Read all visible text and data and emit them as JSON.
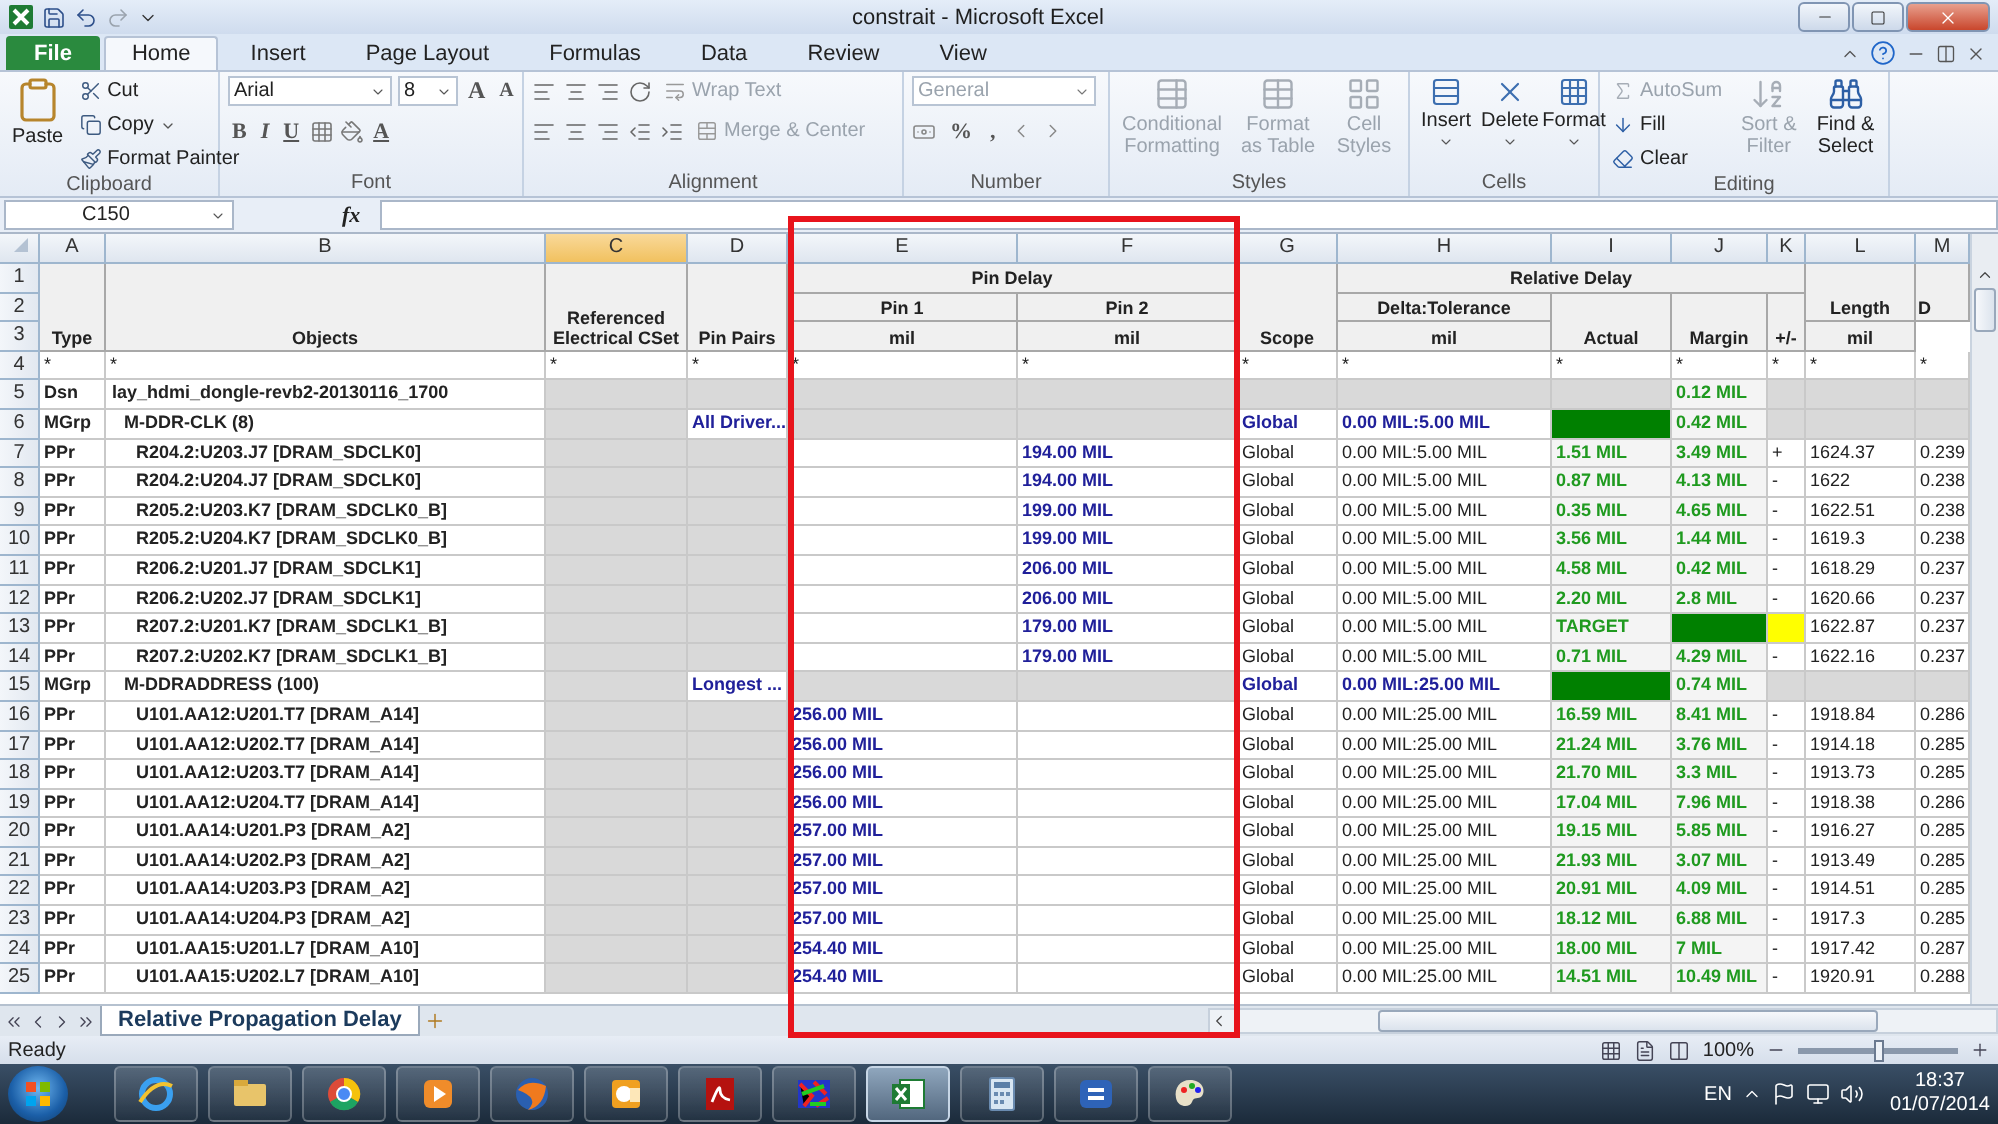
{
  "window": {
    "title": "constrait - Microsoft Excel"
  },
  "ribbon": {
    "tabs": [
      {
        "label": "File",
        "kind": "file",
        "selected": false
      },
      {
        "label": "Home",
        "kind": "tab",
        "selected": true
      },
      {
        "label": "Insert",
        "kind": "tab",
        "selected": false
      },
      {
        "label": "Page Layout",
        "kind": "tab",
        "selected": false
      },
      {
        "label": "Formulas",
        "kind": "tab",
        "selected": false
      },
      {
        "label": "Data",
        "kind": "tab",
        "selected": false
      },
      {
        "label": "Review",
        "kind": "tab",
        "selected": false
      },
      {
        "label": "View",
        "kind": "tab",
        "selected": false
      }
    ],
    "groups": [
      {
        "kind": "clipboard",
        "label": "Clipboard",
        "paste": "Paste",
        "items": [
          {
            "label": "Cut",
            "dropdown": false
          },
          {
            "label": "Copy",
            "dropdown": true
          },
          {
            "label": "Format Painter",
            "dropdown": false
          }
        ]
      },
      {
        "kind": "font",
        "label": "Font",
        "font": "Arial",
        "size": "8",
        "size_buttons": [
          "A",
          "A"
        ],
        "styles": [
          "B",
          "I",
          "U"
        ],
        "color_button": "A"
      },
      {
        "kind": "alignment",
        "label": "Alignment",
        "wrap": {
          "label": "Wrap Text",
          "disabled": true
        },
        "merge": {
          "label": "Merge & Center",
          "disabled": true
        }
      },
      {
        "kind": "number",
        "label": "Number",
        "format": {
          "value": "General",
          "disabled": true
        },
        "symbols": [
          "%",
          ","
        ]
      },
      {
        "kind": "styles",
        "label": "Styles",
        "items": [
          {
            "label": "Conditional Formatting",
            "disabled": true
          },
          {
            "label": "Format as Table",
            "disabled": true
          },
          {
            "label": "Cell Styles",
            "disabled": true
          }
        ]
      },
      {
        "kind": "cells",
        "label": "Cells",
        "items": [
          {
            "label": "Insert",
            "disabled": false
          },
          {
            "label": "Delete",
            "disabled": false
          },
          {
            "label": "Format",
            "disabled": false
          }
        ]
      },
      {
        "kind": "editing",
        "label": "Editing",
        "small": [
          {
            "label": "AutoSum",
            "disabled": true
          },
          {
            "label": "Fill",
            "disabled": false
          },
          {
            "label": "Clear",
            "disabled": false
          }
        ],
        "large": [
          {
            "label": "Sort & Filter",
            "disabled": true
          },
          {
            "label": "Find & Select",
            "disabled": false
          }
        ]
      }
    ]
  },
  "formula_bar": {
    "name_box": "C150",
    "function_label": "fx"
  },
  "sheet": {
    "columns": [
      {
        "letter": "A",
        "selected": false
      },
      {
        "letter": "B",
        "selected": false
      },
      {
        "letter": "C",
        "selected": true
      },
      {
        "letter": "D",
        "selected": false
      },
      {
        "letter": "E",
        "selected": false
      },
      {
        "letter": "F",
        "selected": false
      },
      {
        "letter": "G",
        "selected": false
      },
      {
        "letter": "H",
        "selected": false
      },
      {
        "letter": "I",
        "selected": false
      },
      {
        "letter": "J",
        "selected": false
      },
      {
        "letter": "K",
        "selected": false
      },
      {
        "letter": "L",
        "selected": false
      },
      {
        "letter": "M",
        "selected": false
      }
    ],
    "row_numbers": [
      "1",
      "2",
      "3",
      "4",
      "5",
      "6",
      "7",
      "8",
      "9",
      "10",
      "11",
      "12",
      "13",
      "14",
      "15",
      "16",
      "17",
      "18",
      "19",
      "20",
      "21",
      "22",
      "23",
      "24",
      "25"
    ],
    "header": [
      "Type",
      "Objects",
      "Referenced Electrical CSet",
      "Pin Pairs",
      "Pin Delay",
      "Pin 1",
      "Pin 2",
      "mil",
      "mil",
      "Scope",
      "Relative Delay",
      "Delta:Tolerance",
      "mil",
      "Actual",
      "Margin",
      "+/-",
      "Length",
      "mil",
      "D"
    ],
    "filters": [
      "*",
      "*",
      "*",
      "*",
      "*",
      "*",
      "*",
      "*",
      "*",
      "*",
      "*",
      "*",
      "*"
    ],
    "rows": [
      {
        "kind": "design",
        "type": "Dsn",
        "object": "lay_hdmi_dongle-revb2-20130116_1700",
        "margin": "0.12 MIL",
        "children": [
          {
            "kind": "group",
            "type": "MGrp",
            "object": "M-DDR-CLK (8)",
            "pin_pairs": "All Driver...",
            "scope": "Global",
            "tolerance": "0.00 MIL:5.00 MIL",
            "actual_pass": true,
            "margin": "0.42 MIL",
            "children": [
              {
                "kind": "pair",
                "type": "PPr",
                "object": "R204.2:U203.J7 [DRAM_SDCLK0]",
                "pin2": "194.00 MIL",
                "scope": "Global",
                "tolerance": "0.00 MIL:5.00 MIL",
                "actual": "1.51 MIL",
                "margin": "3.49 MIL",
                "sign": "+",
                "length": "1624.37",
                "col_m": "0.239"
              },
              {
                "kind": "pair",
                "type": "PPr",
                "object": "R204.2:U204.J7 [DRAM_SDCLK0]",
                "pin2": "194.00 MIL",
                "scope": "Global",
                "tolerance": "0.00 MIL:5.00 MIL",
                "actual": "0.87 MIL",
                "margin": "4.13 MIL",
                "sign": "-",
                "length": "1622",
                "col_m": "0.238"
              },
              {
                "kind": "pair",
                "type": "PPr",
                "object": "R205.2:U203.K7 [DRAM_SDCLK0_B]",
                "pin2": "199.00 MIL",
                "scope": "Global",
                "tolerance": "0.00 MIL:5.00 MIL",
                "actual": "0.35 MIL",
                "margin": "4.65 MIL",
                "sign": "-",
                "length": "1622.51",
                "col_m": "0.238"
              },
              {
                "kind": "pair",
                "type": "PPr",
                "object": "R205.2:U204.K7 [DRAM_SDCLK0_B]",
                "pin2": "199.00 MIL",
                "scope": "Global",
                "tolerance": "0.00 MIL:5.00 MIL",
                "actual": "3.56 MIL",
                "margin": "1.44 MIL",
                "sign": "-",
                "length": "1619.3",
                "col_m": "0.238"
              },
              {
                "kind": "pair",
                "type": "PPr",
                "object": "R206.2:U201.J7 [DRAM_SDCLK1]",
                "pin2": "206.00 MIL",
                "scope": "Global",
                "tolerance": "0.00 MIL:5.00 MIL",
                "actual": "4.58 MIL",
                "margin": "0.42 MIL",
                "sign": "-",
                "length": "1618.29",
                "col_m": "0.237"
              },
              {
                "kind": "pair",
                "type": "PPr",
                "object": "R206.2:U202.J7 [DRAM_SDCLK1]",
                "pin2": "206.00 MIL",
                "scope": "Global",
                "tolerance": "0.00 MIL:5.00 MIL",
                "actual": "2.20 MIL",
                "margin": "2.8 MIL",
                "sign": "-",
                "length": "1620.66",
                "col_m": "0.237"
              },
              {
                "kind": "pair",
                "type": "PPr",
                "object": "R207.2:U201.K7 [DRAM_SDCLK1_B]",
                "pin2": "179.00 MIL",
                "scope": "Global",
                "tolerance": "0.00 MIL:5.00 MIL",
                "actual": "TARGET",
                "margin_pass": true,
                "sign_warning": true,
                "length": "1622.87",
                "col_m": "0.237"
              },
              {
                "kind": "pair",
                "type": "PPr",
                "object": "R207.2:U202.K7 [DRAM_SDCLK1_B]",
                "pin2": "179.00 MIL",
                "scope": "Global",
                "tolerance": "0.00 MIL:5.00 MIL",
                "actual": "0.71 MIL",
                "margin": "4.29 MIL",
                "sign": "-",
                "length": "1622.16",
                "col_m": "0.237"
              }
            ]
          },
          {
            "kind": "group",
            "type": "MGrp",
            "object": "M-DDRADDRESS (100)",
            "pin_pairs": "Longest ...",
            "scope": "Global",
            "tolerance": "0.00 MIL:25.00 MIL",
            "actual_pass": true,
            "margin": "0.74 MIL",
            "children": [
              {
                "kind": "pair",
                "type": "PPr",
                "object": "U101.AA12:U201.T7 [DRAM_A14]",
                "pin1": "256.00 MIL",
                "scope": "Global",
                "tolerance": "0.00 MIL:25.00 MIL",
                "actual": "16.59 MIL",
                "margin": "8.41 MIL",
                "sign": "-",
                "length": "1918.84",
                "col_m": "0.286"
              },
              {
                "kind": "pair",
                "type": "PPr",
                "object": "U101.AA12:U202.T7 [DRAM_A14]",
                "pin1": "256.00 MIL",
                "scope": "Global",
                "tolerance": "0.00 MIL:25.00 MIL",
                "actual": "21.24 MIL",
                "margin": "3.76 MIL",
                "sign": "-",
                "length": "1914.18",
                "col_m": "0.285"
              },
              {
                "kind": "pair",
                "type": "PPr",
                "object": "U101.AA12:U203.T7 [DRAM_A14]",
                "pin1": "256.00 MIL",
                "scope": "Global",
                "tolerance": "0.00 MIL:25.00 MIL",
                "actual": "21.70 MIL",
                "margin": "3.3 MIL",
                "sign": "-",
                "length": "1913.73",
                "col_m": "0.285"
              },
              {
                "kind": "pair",
                "type": "PPr",
                "object": "U101.AA12:U204.T7 [DRAM_A14]",
                "pin1": "256.00 MIL",
                "scope": "Global",
                "tolerance": "0.00 MIL:25.00 MIL",
                "actual": "17.04 MIL",
                "margin": "7.96 MIL",
                "sign": "-",
                "length": "1918.38",
                "col_m": "0.286"
              },
              {
                "kind": "pair",
                "type": "PPr",
                "object": "U101.AA14:U201.P3 [DRAM_A2]",
                "pin1": "257.00 MIL",
                "scope": "Global",
                "tolerance": "0.00 MIL:25.00 MIL",
                "actual": "19.15 MIL",
                "margin": "5.85 MIL",
                "sign": "-",
                "length": "1916.27",
                "col_m": "0.285"
              },
              {
                "kind": "pair",
                "type": "PPr",
                "object": "U101.AA14:U202.P3 [DRAM_A2]",
                "pin1": "257.00 MIL",
                "scope": "Global",
                "tolerance": "0.00 MIL:25.00 MIL",
                "actual": "21.93 MIL",
                "margin": "3.07 MIL",
                "sign": "-",
                "length": "1913.49",
                "col_m": "0.285"
              },
              {
                "kind": "pair",
                "type": "PPr",
                "object": "U101.AA14:U203.P3 [DRAM_A2]",
                "pin1": "257.00 MIL",
                "scope": "Global",
                "tolerance": "0.00 MIL:25.00 MIL",
                "actual": "20.91 MIL",
                "margin": "4.09 MIL",
                "sign": "-",
                "length": "1914.51",
                "col_m": "0.285"
              },
              {
                "kind": "pair",
                "type": "PPr",
                "object": "U101.AA14:U204.P3 [DRAM_A2]",
                "pin1": "257.00 MIL",
                "scope": "Global",
                "tolerance": "0.00 MIL:25.00 MIL",
                "actual": "18.12 MIL",
                "margin": "6.88 MIL",
                "sign": "-",
                "length": "1917.3",
                "col_m": "0.285"
              },
              {
                "kind": "pair",
                "type": "PPr",
                "object": "U101.AA15:U201.L7 [DRAM_A10]",
                "pin1": "254.40 MIL",
                "scope": "Global",
                "tolerance": "0.00 MIL:25.00 MIL",
                "actual": "18.00 MIL",
                "margin": "7 MIL",
                "sign": "-",
                "length": "1917.42",
                "col_m": "0.287"
              },
              {
                "kind": "pair",
                "type": "PPr",
                "object": "U101.AA15:U202.L7 [DRAM_A10]",
                "pin1": "254.40 MIL",
                "scope": "Global",
                "tolerance": "0.00 MIL:25.00 MIL",
                "actual": "14.51 MIL",
                "margin": "10.49 MIL",
                "sign": "-",
                "length": "1920.91",
                "col_m": "0.288"
              }
            ]
          }
        ]
      }
    ]
  },
  "annotation": {
    "kind": "frame"
  },
  "sheet_tabs": [
    {
      "label": "Relative Propagation Delay",
      "selected": true
    }
  ],
  "status_bar": {
    "text": "Ready",
    "zoom": {
      "label": "100%",
      "level": 0.5
    }
  },
  "taskbar": {
    "apps": [
      {
        "selected": false
      },
      {
        "selected": false
      },
      {
        "selected": false
      },
      {
        "selected": false
      },
      {
        "selected": false
      },
      {
        "selected": false
      },
      {
        "selected": false
      },
      {
        "selected": false
      },
      {
        "selected": true
      },
      {
        "selected": false
      },
      {
        "selected": false
      },
      {
        "selected": false
      }
    ],
    "language": "EN",
    "time": "18:37",
    "date": "01/07/2014"
  }
}
